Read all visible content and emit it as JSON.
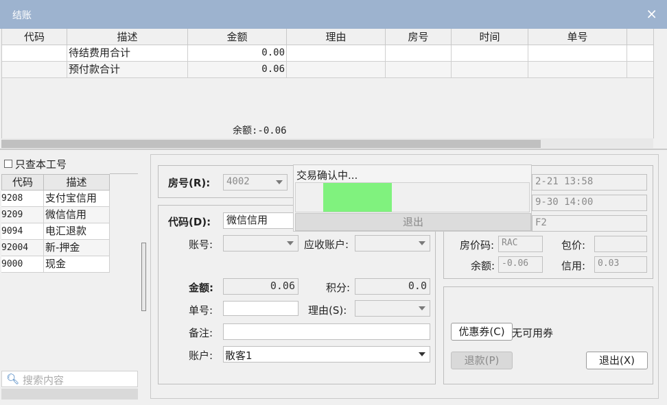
{
  "window": {
    "title": "结账",
    "close_glyph": "×"
  },
  "grid": {
    "columns": [
      "代码",
      "描述",
      "金额",
      "理由",
      "房号",
      "时间",
      "单号"
    ],
    "rows": [
      {
        "code": "",
        "desc": "待结费用合计",
        "amount": "0.00",
        "reason": "",
        "room": "",
        "time": "",
        "no": ""
      },
      {
        "code": "",
        "desc": "预付款合计",
        "amount": "0.06",
        "reason": "",
        "room": "",
        "time": "",
        "no": ""
      }
    ],
    "balance": "余额:-0.06"
  },
  "left": {
    "only_me_label": "只查本工号",
    "only_me_checked": false,
    "columns": [
      "代码",
      "描述"
    ],
    "items": [
      {
        "code": "9208",
        "desc": "支付宝信用"
      },
      {
        "code": "9209",
        "desc": "微信信用"
      },
      {
        "code": "9094",
        "desc": "电汇退款"
      },
      {
        "code": "92004",
        "desc": "新-押金"
      },
      {
        "code": "9000",
        "desc": "现金"
      }
    ],
    "search_placeholder": "搜索内容",
    "search_icon": "search-icon"
  },
  "form": {
    "room_label": "房号(R):",
    "room_value": "4002",
    "code_label": "代码(D):",
    "code_value": "微信信用",
    "account_no_label": "账号:",
    "receivable_label": "应收账户:",
    "amount_label": "金额:",
    "amount_value": "0.06",
    "points_label": "积分:",
    "points_value": "0.0",
    "bill_no_label": "单号:",
    "reason_label": "理由(S):",
    "remark_label": "备注:",
    "account_label": "账户:",
    "account_value": "散客1"
  },
  "info": {
    "arrive_time": "2-21 13:58",
    "leave_time": "9-30 14:00",
    "guest": "F2",
    "rate_code_label": "房价码:",
    "rate_code_value": "RAC",
    "package_label": "包价:",
    "package_value": "",
    "balance_label": "余额:",
    "balance_value": "-0.06",
    "credit_label": "信用:",
    "credit_value": "0.03"
  },
  "actions": {
    "coupon_button": "优惠券(C)",
    "coupon_status": "无可用券",
    "refund_button": "退款(P)",
    "exit_button": "退出(X)"
  },
  "popup": {
    "title": "交易确认中...",
    "exit_button": "退出",
    "progress_color": "#80f27e"
  }
}
